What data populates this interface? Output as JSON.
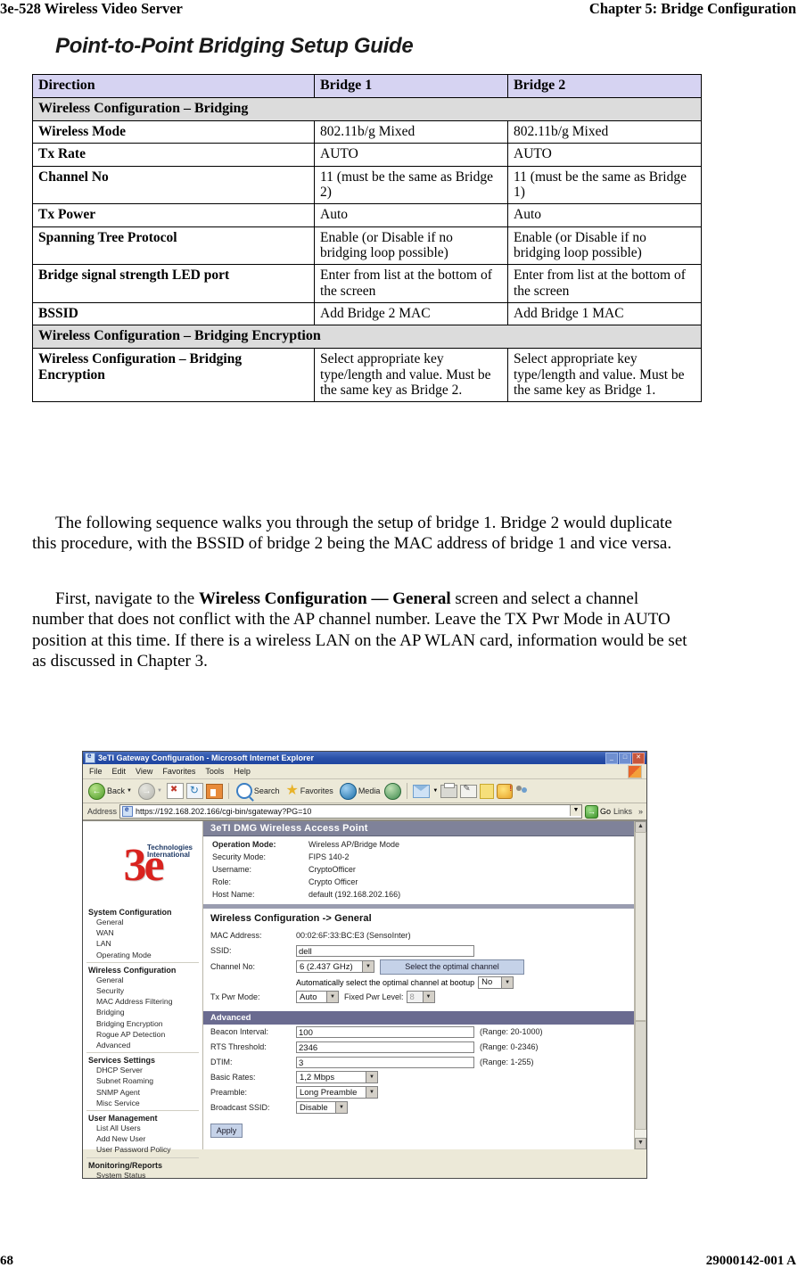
{
  "runhead": {
    "left": "3e-528 Wireless Video Server",
    "right": "Chapter 5: Bridge Configuration"
  },
  "page_title": "Point-to-Point Bridging Setup Guide",
  "table": {
    "headers": [
      "Direction",
      "Bridge 1",
      "Bridge 2"
    ],
    "section1": "Wireless Configuration – Bridging",
    "rows": [
      {
        "label": "Wireless Mode",
        "b1": "802.11b/g Mixed",
        "b2": "802.11b/g Mixed"
      },
      {
        "label": "Tx Rate",
        "b1": "AUTO",
        "b2": "AUTO"
      },
      {
        "label": "Channel No",
        "b1": "11 (must be the same as Bridge 2)",
        "b2": "11 (must be the same as Bridge 1)"
      },
      {
        "label": "Tx Power",
        "b1": "Auto",
        "b2": "Auto"
      },
      {
        "label": "Spanning Tree Protocol",
        "b1": "Enable (or Disable if no bridging loop possible)",
        "b2": "Enable (or Disable if no bridging loop possible)"
      },
      {
        "label": "Bridge signal strength LED port",
        "b1": "Enter from list at the bottom of the screen",
        "b2": "Enter from list at the bottom of the screen"
      },
      {
        "label": "BSSID",
        "b1": "Add Bridge 2 MAC",
        "b2": "Add Bridge 1 MAC"
      }
    ],
    "section2": "Wireless Configuration – Bridging Encryption",
    "rows2": [
      {
        "label": "Wireless Configuration – Bridging Encryption",
        "b1": "Select appropriate key type/length and value. Must be the same key as Bridge 2.",
        "b2": "Select appropriate key type/length and value. Must be the same key as Bridge 1."
      }
    ]
  },
  "body": {
    "para1": "The following sequence walks you through the setup of bridge 1. Bridge 2 would duplicate this procedure, with the BSSID of bridge 2 being the MAC address of bridge 1 and vice versa.",
    "para2_a": "First, navigate to the ",
    "para2_bold": "Wireless Configuration — General",
    "para2_b": " screen and select a channel number that does not conflict with the AP channel number. Leave the TX Pwr Mode in AUTO position at this time. If there is a wireless LAN on the AP WLAN card, information would be set as discussed in Chapter 3."
  },
  "browser": {
    "window_title": "3eTI Gateway Configuration - Microsoft Internet Explorer",
    "window_buttons": {
      "minimize": "_",
      "maximize": "□",
      "close": "✕"
    },
    "menu": [
      "File",
      "Edit",
      "View",
      "Favorites",
      "Tools",
      "Help"
    ],
    "toolbar": {
      "back": "Back",
      "forward": "",
      "stop": "",
      "refresh": "",
      "home": "",
      "search": "Search",
      "favorites": "Favorites",
      "media": "Media",
      "history": "",
      "mail": "",
      "print": "",
      "edit": "",
      "notes": "",
      "messenger": "",
      "people": ""
    },
    "address": {
      "label": "Address",
      "url": "https://192.168.202.166/cgi-bin/sgateway?PG=10",
      "go": "Go",
      "links": "Links",
      "chevron": "»"
    }
  },
  "webpage": {
    "logo": {
      "mark": "3e",
      "line1": "Technologies",
      "line2": "International"
    },
    "nav": [
      {
        "type": "group",
        "label": "System Configuration"
      },
      {
        "type": "item",
        "label": "General"
      },
      {
        "type": "item",
        "label": "WAN"
      },
      {
        "type": "item",
        "label": "LAN"
      },
      {
        "type": "item",
        "label": "Operating Mode"
      },
      {
        "type": "group",
        "label": "Wireless Configuration"
      },
      {
        "type": "item",
        "label": "General"
      },
      {
        "type": "item",
        "label": "Security"
      },
      {
        "type": "item",
        "label": "MAC Address Filtering"
      },
      {
        "type": "item",
        "label": "Bridging"
      },
      {
        "type": "item",
        "label": "Bridging Encryption"
      },
      {
        "type": "item",
        "label": "Rogue AP Detection"
      },
      {
        "type": "item",
        "label": "Advanced"
      },
      {
        "type": "group",
        "label": "Services Settings"
      },
      {
        "type": "item",
        "label": "DHCP Server"
      },
      {
        "type": "item",
        "label": "Subnet Roaming"
      },
      {
        "type": "item",
        "label": "SNMP Agent"
      },
      {
        "type": "item",
        "label": "Misc Service"
      },
      {
        "type": "group",
        "label": "User Management"
      },
      {
        "type": "item",
        "label": "List All Users"
      },
      {
        "type": "item",
        "label": "Add New User"
      },
      {
        "type": "item",
        "label": "User Password Policy"
      },
      {
        "type": "group",
        "label": "Monitoring/Reports"
      },
      {
        "type": "item",
        "label": "System Status"
      }
    ],
    "ap_banner": "3eTI DMG Wireless Access Point",
    "info": [
      {
        "k": "Operation Mode:",
        "v": "Wireless AP/Bridge Mode"
      },
      {
        "k": "Security Mode:",
        "v": "FIPS 140-2"
      },
      {
        "k": "Username:",
        "v": "CryptoOfficer"
      },
      {
        "k": "Role:",
        "v": "Crypto Officer"
      },
      {
        "k": "Host Name:",
        "v": "default (192.168.202.166)"
      }
    ],
    "section_title": "Wireless Configuration -> General",
    "general": {
      "mac_label": "MAC Address:",
      "mac_value": "00:02:6F:33:BC:E3 (SensoInter)",
      "ssid_label": "SSID:",
      "ssid_value": "dell",
      "channel_label": "Channel No:",
      "channel_value": "6 (2.437 GHz)",
      "optimal_button": "Select the optimal channel",
      "auto_text": "Automatically select the optimal channel at bootup",
      "auto_value": "No",
      "txpwr_label": "Tx Pwr Mode:",
      "txpwr_value": "Auto",
      "fixed_label": "Fixed Pwr Level:",
      "fixed_value": "8"
    },
    "advanced": {
      "banner": "Advanced",
      "rows": [
        {
          "label": "Beacon Interval:",
          "value": "100",
          "range": "(Range: 20-1000)"
        },
        {
          "label": "RTS Threshold:",
          "value": "2346",
          "range": "(Range: 0-2346)"
        },
        {
          "label": "DTIM:",
          "value": "3",
          "range": "(Range: 1-255)"
        }
      ],
      "basic_rates_label": "Basic Rates:",
      "basic_rates_value": "1,2 Mbps",
      "preamble_label": "Preamble:",
      "preamble_value": "Long Preamble",
      "broadcast_label": "Broadcast SSID:",
      "broadcast_value": "Disable",
      "apply": "Apply"
    },
    "scroll": {
      "up": "▲",
      "down": "▼"
    }
  },
  "footer": {
    "left": "68",
    "right": "29000142-001 A"
  },
  "colors": {
    "table_header": "#d6d3f2",
    "table_section": "#dcdcdc",
    "ap_banner": "#7f8299",
    "advanced_banner": "#6a6b90",
    "button": "#c5d2e8",
    "logo_red": "#d9231f"
  }
}
